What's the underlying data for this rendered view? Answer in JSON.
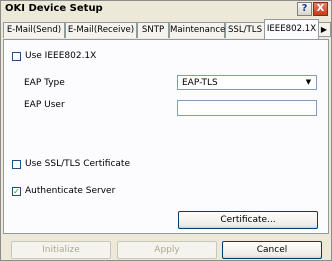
{
  "window": {
    "title": "OKI Device Setup"
  },
  "titlebar": {
    "help_label": "?",
    "close_label": "X"
  },
  "tabs": [
    {
      "label": "E-Mail(Send)"
    },
    {
      "label": "E-Mail(Receive)"
    },
    {
      "label": "SNTP"
    },
    {
      "label": "Maintenance"
    },
    {
      "label": "SSL/TLS"
    },
    {
      "label": "IEEE802.1X",
      "active": true
    }
  ],
  "tab_scroll": {
    "left": "◀",
    "right": "▶"
  },
  "form": {
    "use_ieee": {
      "label": "Use IEEE802.1X",
      "checked": false,
      "mark": ""
    },
    "eap_type": {
      "label": "EAP Type",
      "value": "EAP-TLS",
      "arrow": "▼"
    },
    "eap_user": {
      "label": "EAP User",
      "value": ""
    },
    "use_ssl_cert": {
      "label": "Use SSL/TLS Certificate",
      "checked": false,
      "mark": ""
    },
    "auth_server": {
      "label": "Authenticate Server",
      "checked": true,
      "mark": "✓"
    },
    "certificate_button": "Certificate..."
  },
  "footer": {
    "initialize": "Initialize",
    "apply": "Apply",
    "cancel": "Cancel"
  }
}
